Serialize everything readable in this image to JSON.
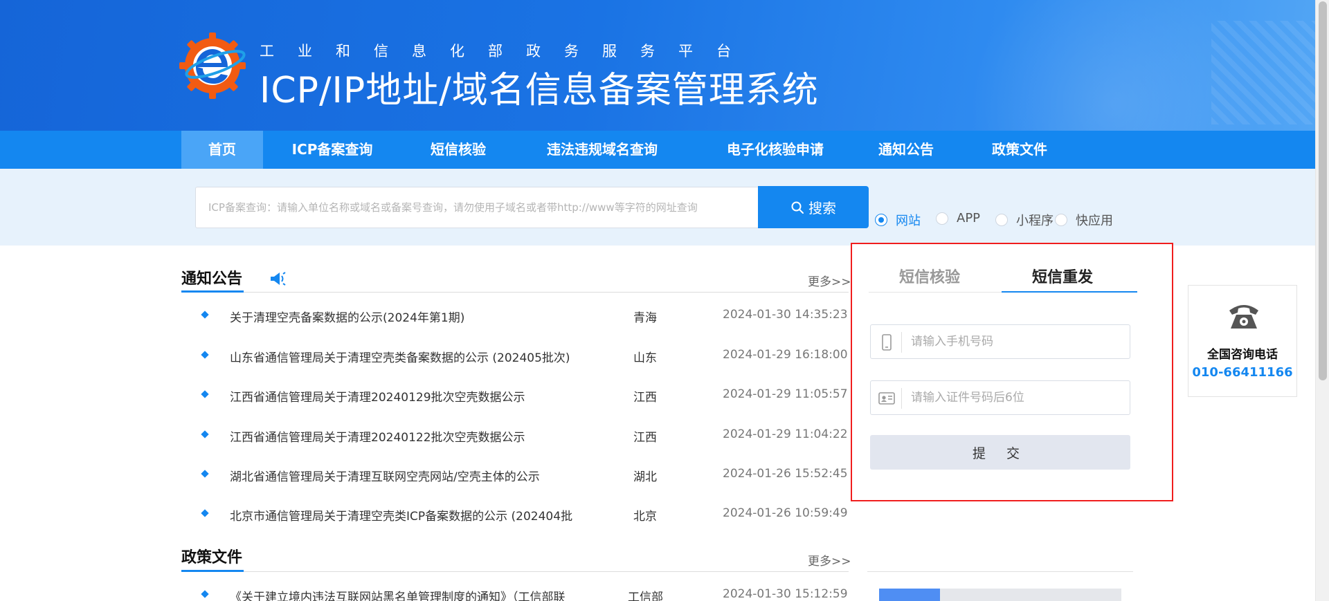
{
  "header": {
    "subtitle": "工业和信息化部政务服务平台",
    "title": "ICP/IP地址/域名信息备案管理系统",
    "logo_icon": "globe-e-logo",
    "colors": {
      "banner": "#1a73e4",
      "nav": "#1487f0",
      "nav_active": "#4aa5f7"
    }
  },
  "nav": {
    "items": [
      {
        "label": "首页",
        "active": true
      },
      {
        "label": "ICP备案查询"
      },
      {
        "label": "短信核验"
      },
      {
        "label": "违法违规域名查询"
      },
      {
        "label": "电子化核验申请"
      },
      {
        "label": "通知公告"
      },
      {
        "label": "政策文件"
      }
    ]
  },
  "search": {
    "placeholder": "ICP备案查询：请输入单位名称或域名或备案号查询，请勿使用子域名或者带http://www等字符的网址查询",
    "button_label": "搜索",
    "button_icon": "search-icon",
    "types": [
      {
        "label": "网站",
        "checked": true
      },
      {
        "label": "APP"
      },
      {
        "label": "小程序"
      },
      {
        "label": "快应用"
      }
    ]
  },
  "notices": {
    "title": "通知公告",
    "icon": "megaphone-icon",
    "more": "更多>>",
    "items": [
      {
        "title": "关于清理空壳备案数据的公示(2024年第1期)",
        "region": "青海",
        "date": "2024-01-30 14:35:23"
      },
      {
        "title": "山东省通信管理局关于清理空壳类备案数据的公示 (202405批次)",
        "region": "山东",
        "date": "2024-01-29 16:18:00"
      },
      {
        "title": "江西省通信管理局关于清理20240129批次空壳数据公示",
        "region": "江西",
        "date": "2024-01-29 11:05:57"
      },
      {
        "title": "江西省通信管理局关于清理20240122批次空壳数据公示",
        "region": "江西",
        "date": "2024-01-29 11:04:22"
      },
      {
        "title": "湖北省通信管理局关于清理互联网空壳网站/空壳主体的公示",
        "region": "湖北",
        "date": "2024-01-26 15:52:45"
      },
      {
        "title": "北京市通信管理局关于清理空壳类ICP备案数据的公示 (202404批",
        "region": "北京",
        "date": "2024-01-26 10:59:49"
      }
    ]
  },
  "policies": {
    "title": "政策文件",
    "more": "更多>>",
    "items": [
      {
        "title": "《关于建立境内违法互联网站黑名单管理制度的通知》（工信部联",
        "region": "工信部",
        "date": "2024-01-30 15:12:59"
      }
    ]
  },
  "sms": {
    "tabs": [
      {
        "label": "短信核验",
        "active": false
      },
      {
        "label": "短信重发",
        "active": true
      }
    ],
    "phone_placeholder": "请输入手机号码",
    "phone_icon": "mobile-phone-icon",
    "id_placeholder": "请输入证件号码后6位",
    "id_icon": "id-card-icon",
    "submit_label": "提 交"
  },
  "hotline": {
    "icon": "telephone-icon",
    "label": "全国咨询电话",
    "number": "010-66411166"
  },
  "bottom_progress": {
    "value": 0.25
  }
}
